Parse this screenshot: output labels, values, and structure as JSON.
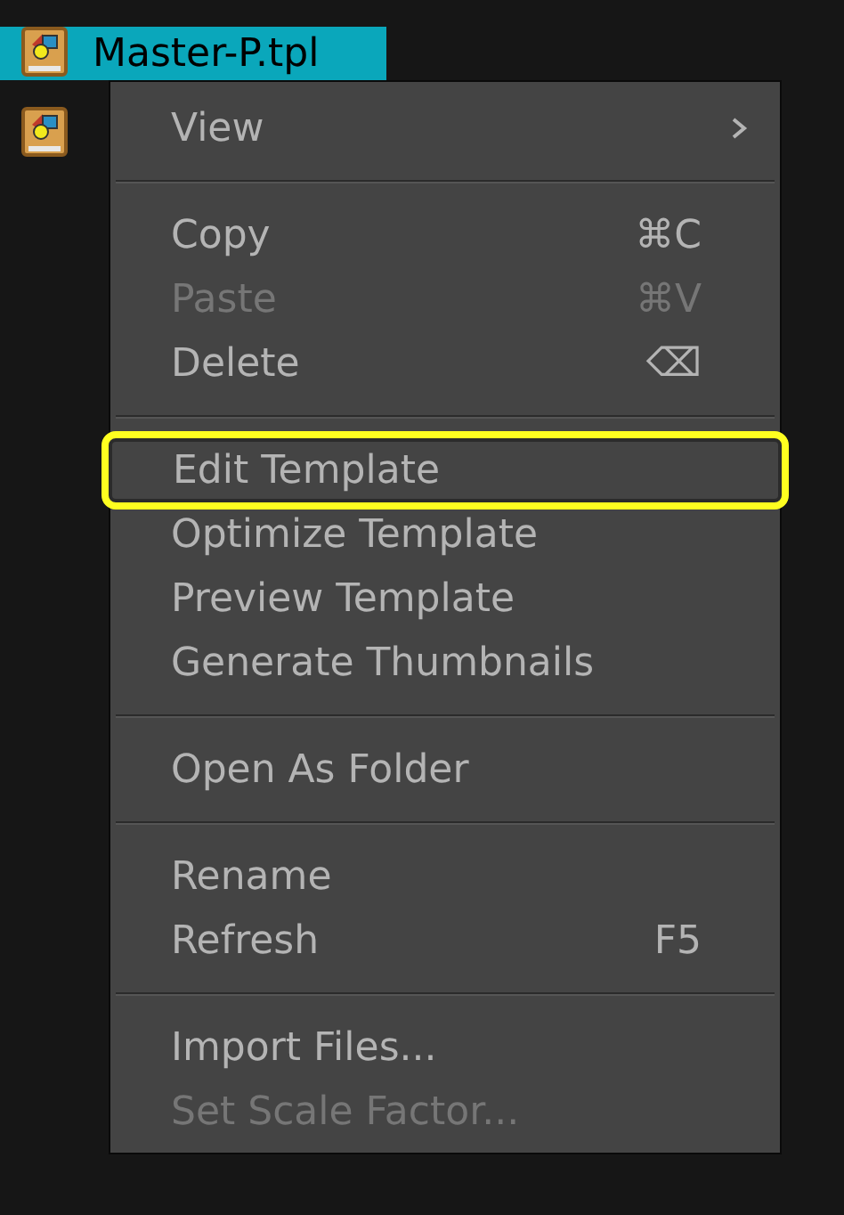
{
  "files": [
    {
      "name": "Master-P.tpl",
      "selected": true
    },
    {
      "selected": false
    }
  ],
  "context_menu": {
    "groups": [
      {
        "items": [
          {
            "label": "View",
            "submenu": true,
            "disabled": false,
            "highlighted": false
          }
        ]
      },
      {
        "items": [
          {
            "label": "Copy",
            "shortcut": "⌘C",
            "disabled": false,
            "highlighted": false
          },
          {
            "label": "Paste",
            "shortcut": "⌘V",
            "disabled": true,
            "highlighted": false
          },
          {
            "label": "Delete",
            "shortcut": "⌫",
            "disabled": false,
            "highlighted": false
          }
        ]
      },
      {
        "items": [
          {
            "label": "Edit Template",
            "disabled": false,
            "highlighted": true
          },
          {
            "label": "Optimize Template",
            "disabled": false,
            "highlighted": false
          },
          {
            "label": "Preview Template",
            "disabled": false,
            "highlighted": false
          },
          {
            "label": "Generate Thumbnails",
            "disabled": false,
            "highlighted": false
          }
        ]
      },
      {
        "items": [
          {
            "label": "Open As Folder",
            "disabled": false,
            "highlighted": false
          }
        ]
      },
      {
        "items": [
          {
            "label": "Rename",
            "disabled": false,
            "highlighted": false
          },
          {
            "label": "Refresh",
            "shortcut": "F5",
            "disabled": false,
            "highlighted": false
          }
        ]
      },
      {
        "items": [
          {
            "label": "Import Files...",
            "disabled": false,
            "highlighted": false
          },
          {
            "label": "Set Scale Factor...",
            "disabled": true,
            "highlighted": false
          }
        ]
      }
    ]
  }
}
